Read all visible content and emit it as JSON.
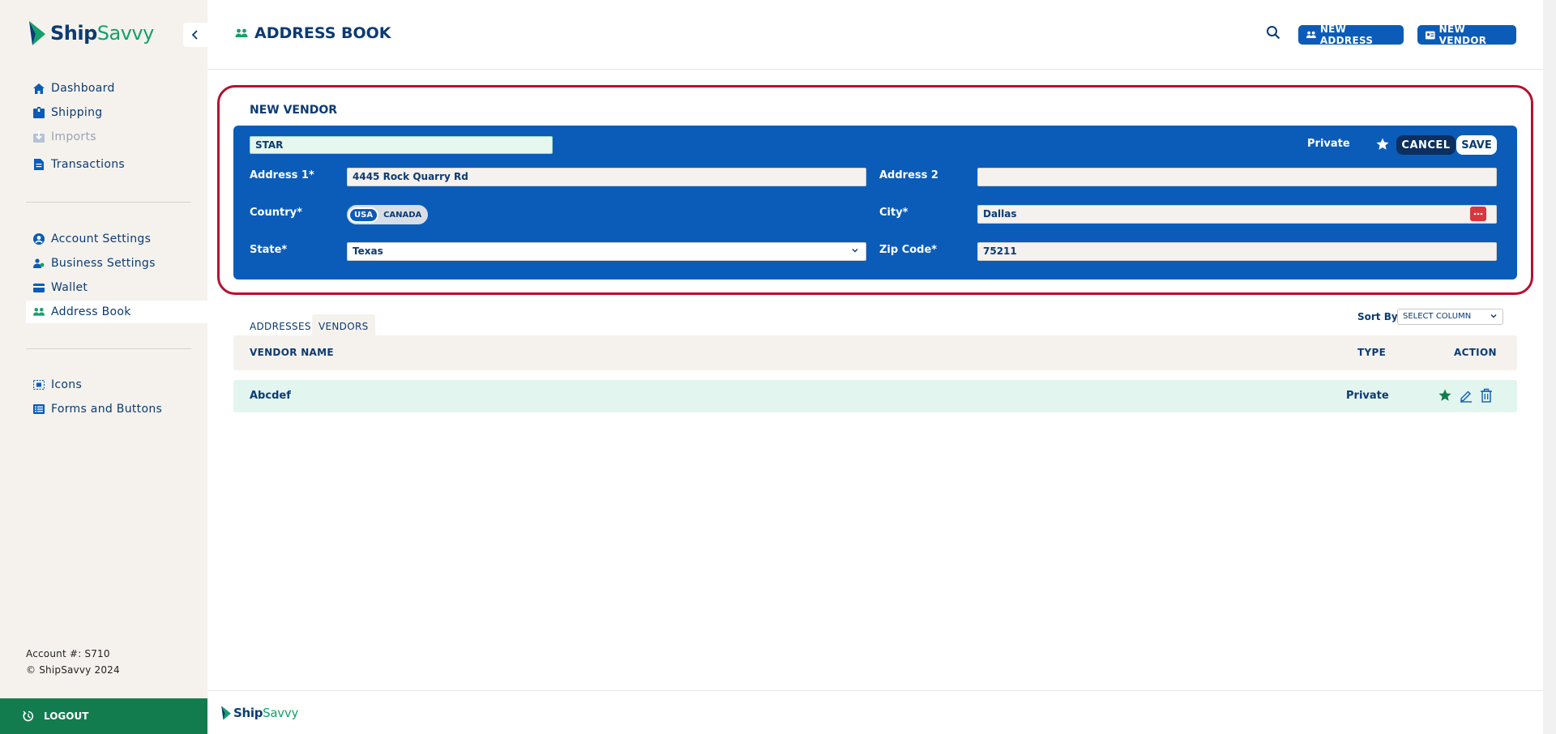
{
  "brand": {
    "name_part1": "Ship",
    "name_part2": "Savvy"
  },
  "sidebar": {
    "items": [
      {
        "label": "Dashboard",
        "icon": "home-icon"
      },
      {
        "label": "Shipping",
        "icon": "box-icon"
      },
      {
        "label": "Imports",
        "icon": "import-icon",
        "disabled": true
      },
      {
        "label": "Transactions",
        "icon": "document-icon"
      },
      {
        "label": "Account Settings",
        "icon": "user-circle-icon"
      },
      {
        "label": "Business Settings",
        "icon": "business-users-icon"
      },
      {
        "label": "Wallet",
        "icon": "card-icon"
      },
      {
        "label": "Address Book",
        "icon": "address-book-icon",
        "active": true
      },
      {
        "label": "Icons",
        "icon": "icons-grid-icon"
      },
      {
        "label": "Forms and Buttons",
        "icon": "list-icon"
      }
    ],
    "account_number": "Account #: S710",
    "copyright": "© ShipSavvy 2024",
    "logout_label": "LOGOUT"
  },
  "header": {
    "title": "ADDRESS BOOK",
    "new_address_label": "NEW ADDRESS",
    "new_vendor_label": "NEW VENDOR"
  },
  "vendor_form": {
    "heading": "NEW VENDOR",
    "vendor_name_value": "STAR",
    "private_label": "Private",
    "cancel_label": "CANCEL",
    "save_label": "SAVE",
    "address1_label": "Address 1*",
    "address1_value": "4445 Rock Quarry Rd",
    "address2_label": "Address 2",
    "address2_value": "",
    "country_label": "Country*",
    "country_options": [
      "USA",
      "CANADA"
    ],
    "country_selected": "USA",
    "city_label": "City*",
    "city_value": "Dallas",
    "state_label": "State*",
    "state_value": "Texas",
    "zip_label": "Zip Code*",
    "zip_value": "75211"
  },
  "tabs": [
    {
      "label": "ADDRESSES"
    },
    {
      "label": "VENDORS",
      "active": true
    }
  ],
  "sort": {
    "label": "Sort By",
    "value": "SELECT COLUMN"
  },
  "table": {
    "columns": [
      "VENDOR NAME",
      "TYPE",
      "ACTION"
    ],
    "rows": [
      {
        "vendor_name": "Abcdef",
        "type": "Private"
      }
    ]
  },
  "colors": {
    "primary_blue": "#0b5cb8",
    "navy": "#0b3b73",
    "brand_green": "#14a06a",
    "logout_green": "#137c4f",
    "highlight_red": "#b5122f"
  }
}
